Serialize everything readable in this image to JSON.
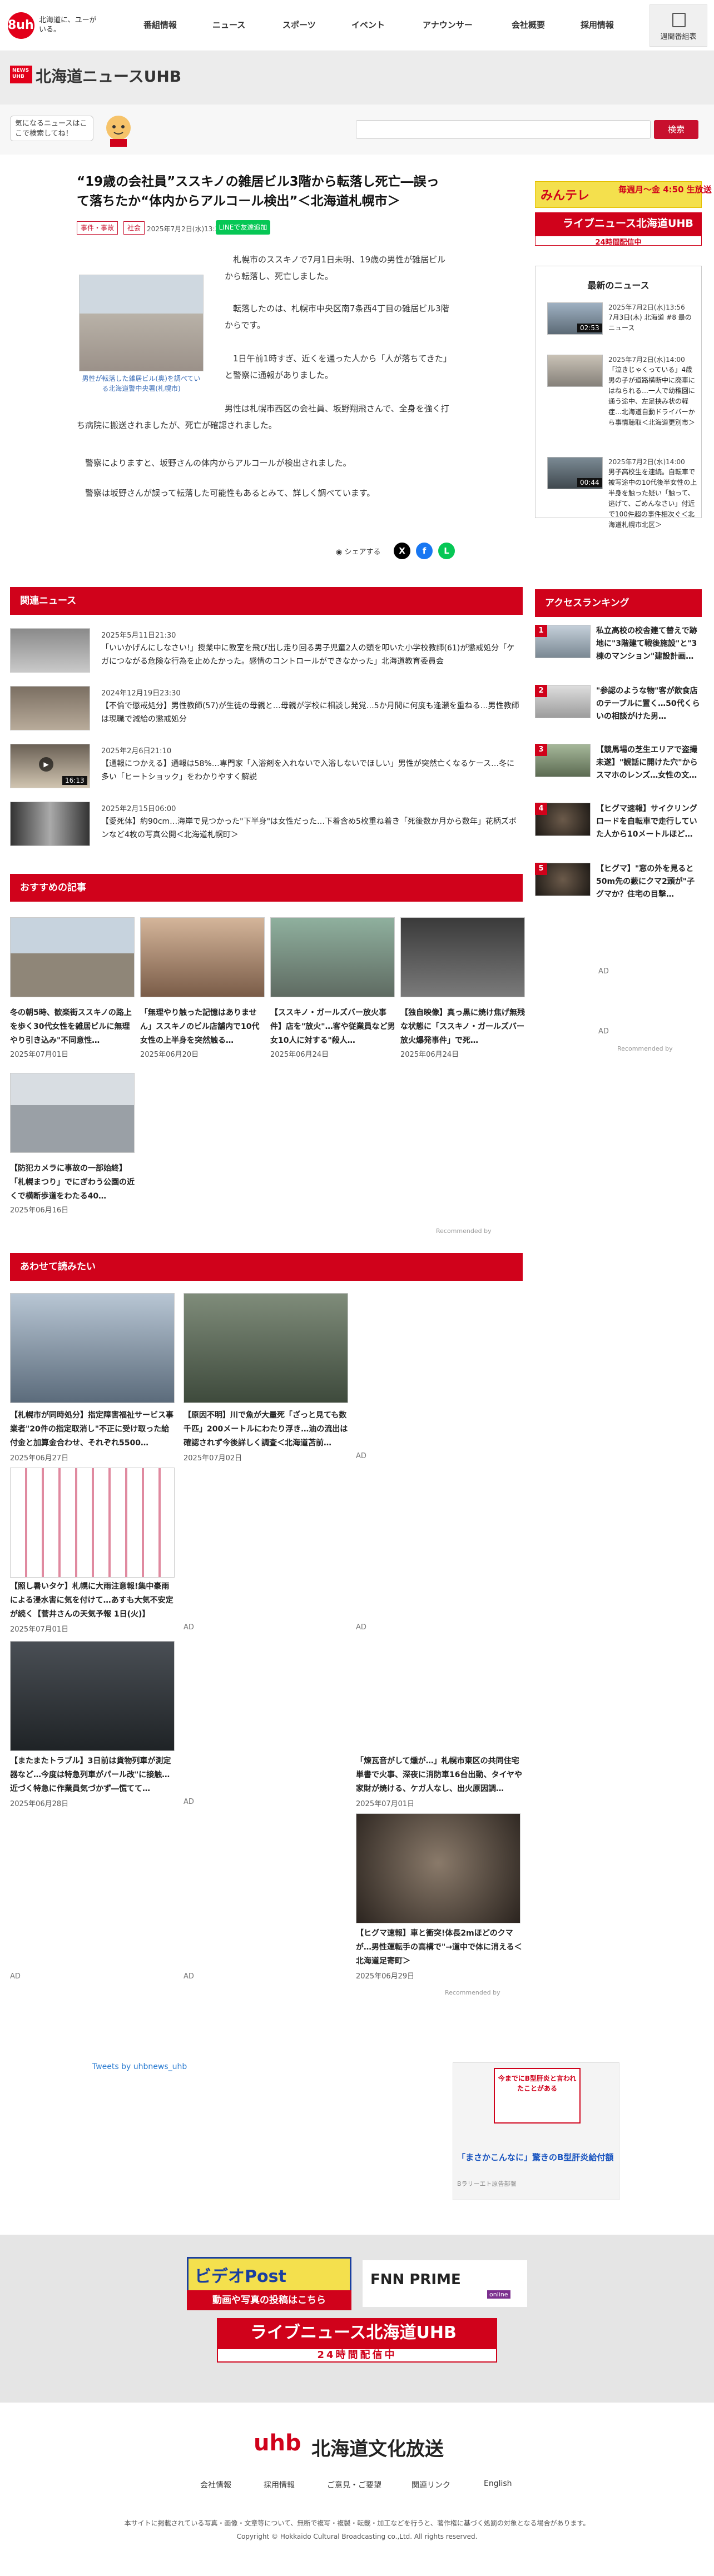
{
  "header": {
    "logo_badge": "8uhb",
    "tagline": "北海道に、ユーがいる。",
    "nav": [
      "番組情報",
      "ニュース",
      "スポーツ",
      "イベント",
      "アナウンサー",
      "会社概要",
      "採用情報"
    ],
    "weekly": "週間番組表"
  },
  "news_header": {
    "logo": "NEWS UHB",
    "title": "北海道ニュースUHB"
  },
  "search": {
    "bubble": "気になるニュースはここで検索してね！",
    "button": "検索",
    "placeholder": ""
  },
  "article": {
    "title": "“19歳の会社員”ススキノの雑居ビル3階から転落し死亡―誤って落ちたか“体内からアルコール検出”＜北海道札幌市＞",
    "tags": [
      "事件・事故",
      "社会"
    ],
    "date": "2025年7月2日(水)13:34",
    "line": "LINEで友達追加",
    "caption": "男性が転落した雑居ビル(奥)を調べている北海道警中央署(札幌市)",
    "paragraphs": [
      "札幌市のススキノで7月1日未明、19歳の男性が雑居ビルから転落し、死亡しました。",
      "転落したのは、札幌市中央区南7条西4丁目の雑居ビル3階からです。",
      "1日午前1時すぎ、近くを通った人から「人が落ちてきた」と警察に通報がありました。",
      "男性は札幌市西区の会社員、坂野翔飛さんで、全身を強く打ち病院に搬送されましたが、死亡が確認されました。",
      "警察によりますと、坂野さんの体内からアルコールが検出されました。",
      "警察は坂野さんが誤って転落した可能性もあるとみて、詳しく調べています。"
    ],
    "share": "シェアする"
  },
  "related": {
    "heading": "関連ニュース",
    "items": [
      {
        "date": "2025年5月11日21:30",
        "title": "「いいかげんにしなさい!」授業中に教室を飛び出し走り回る男子児童2人の頭を叩いた小学校教師(61)が懲戒処分「ケガにつながる危険な行為を止めたかった。感情のコントロールができなかった」北海道教育委員会"
      },
      {
        "date": "2024年12月19日23:30",
        "title": "【不倫で懲戒処分】男性教師(57)が生徒の母親と…母親が学校に相談し発覚…5か月間に何度も逢瀬を重ねる…男性教師は現職で減給の懲戒処分"
      },
      {
        "date": "2025年2月6日21:10",
        "title": "【通報につかえる】通報は58%…専門家「入浴剤を入れないで入浴しないでほしい」男性が突然亡くなるケース…冬に多い「ヒートショック」をわかりやすく解説",
        "duration": "16:13"
      },
      {
        "date": "2025年2月15日06:00",
        "title": "【愛死体】約90cm…海岸で見つかった\"下半身\"は女性だった…下着含め5枚重ね着き「死後数か月から数年」花柄ズボンなど4枚の写真公開＜北海道札幌町＞"
      }
    ]
  },
  "recommended": {
    "heading": "おすすめの記事",
    "items": [
      {
        "title": "冬の朝5時、歓楽街ススキノの路上を歩く30代女性を雑居ビルに無理やり引き込み\"不同意性…",
        "date": "2025年07月01日"
      },
      {
        "title": "「無理やり触った記憶はありません」ススキノのビル店舗内で10代女性の上半身を突然触る…",
        "date": "2025年06月20日"
      },
      {
        "title": "【ススキノ・ガールズバー放火事件】店を\"放火\"…客や従業員など男女10人に対する\"殺人…",
        "date": "2025年06月24日"
      },
      {
        "title": "【独自映像】真っ黒に焼け焦げ無残な状態に「ススキノ・ガールズバー放火爆発事件」で死…",
        "date": "2025年06月24日"
      },
      {
        "title": "【防犯カメラに事故の一部始終】「札幌まつり」でにぎわう公園の近くで横断歩道をわたる40…",
        "date": "2025年06月16日"
      }
    ],
    "powered": "Recommended by"
  },
  "also_read": {
    "heading": "あわせて読みたい",
    "items": [
      {
        "title": "【札幌市が同時処分】指定障害福祉サービス事業者\"20件の指定取消し\"不正に受け取った給付金と加算金合わせ、それぞれ5500…",
        "date": "2025年06月27日"
      },
      {
        "title": "【原因不明】川で魚が大量死「ざっと見ても数千匹」200メートルにわたり浮き…油の流出は確認されず今後詳しく調査＜北海道苫前…",
        "date": "2025年07月02日"
      },
      {
        "title": "【照し暑いタケ】札幌に大雨注意報!集中豪雨による浸水害に気を付けて…あすも大気不安定が続く【菅井さんの天気予報 1日(火)】",
        "date": "2025年07月01日"
      },
      {
        "title": "【またまたトラブル】3日前は貨物列車が測定器など…今度は特急列車がパール改\"に接触…近づく特急に作業員気づかず―慌てて…",
        "date": "2025年06月28日"
      },
      {
        "title": "「煉瓦音がして燻が…」札幌市東区の共同住宅単書で火事、深夜に消防車16台出動、タイヤや家財が焼ける、ケガ人なし、出火原因調…",
        "date": "2025年07月01日"
      },
      {
        "title": "【ヒグマ速報】車と衝突!体長2mほどのクマが…男性運転手の高構で\"→道中で体に消える＜北海道足寄町＞",
        "date": "2025年06月29日"
      }
    ],
    "ad": "AD",
    "powered": "Recommended by"
  },
  "sidebar": {
    "mita_logo": "みんテレ",
    "mita_time": "毎週月〜金 4:50 生放送",
    "live_banner": "ライブニュース北海道UHB",
    "live_sub": "24時間配信中",
    "latest_heading": "最新のニュース",
    "latest": [
      {
        "date": "2025年7月2日(水)13:56",
        "title": "7月3日(木) 北海道 #8 最のニュース",
        "duration": "02:53"
      },
      {
        "date": "2025年7月2日(水)14:00",
        "title": "「泣きじゃくっている」4歳男の子が道路横断中に廃車にはねられる…一人で幼稚園に通う途中、左足挟み状の軽症…北海道自動ドライバーから事情聴取＜北海道更別市＞"
      },
      {
        "date": "2025年7月2日(水)14:00",
        "title": "男子高校生を連続。自転車で被写途中の10代後半女性の上半身を触った疑い「触って、逃げて、ごめんなさい」付近で100件超の事件相次ぐ＜北海道札幌市北区＞",
        "duration": "00:44"
      }
    ],
    "rank_heading": "アクセスランキング",
    "ranking": [
      {
        "n": "1",
        "title": "私立高校の校舎建て替えで跡地に\"3階建て戦後施設\"と\"3棟のマンション\"建設計画…"
      },
      {
        "n": "2",
        "title": "\"参認のような物\"客が飲食店のテーブルに置く…50代くらいの相談がけた男…"
      },
      {
        "n": "3",
        "title": "【競馬場の芝生エリアで盗撮未遂】\"観話に開けた穴\"からスマホのレンズ…女性の文…"
      },
      {
        "n": "4",
        "title": "【ヒグマ速報】サイクリングロードを自転車で走行していた人から10メートルほど…"
      },
      {
        "n": "5",
        "title": "【ヒグマ】\"窓の外を見ると50m先の藪にクマ2頭が\"子グマか？住宅の目撃…"
      }
    ],
    "ad": "AD",
    "powered": "Recommended by"
  },
  "footer": {
    "twitter": "Tweets by uhbnews_uhb",
    "ad_top": "今までにB型肝炎と言われたことがある",
    "ad_title": "「まさかこんなに」驚きのB型肝炎給付額",
    "ad_sub": "Bラリーエト原告部署",
    "videopost": "ビデオPost",
    "videopost_sub": "動画や写真の投稿はこちら",
    "fnn": "FNN PRIME",
    "fnn_sub": "online",
    "live2": "ライブニュース北海道UHB",
    "live2_sub": "24時間配信中",
    "corp_logo": "uhb",
    "corp_name": "北海道文化放送",
    "nav": [
      "会社情報",
      "採用情報",
      "ご意見・ご要望",
      "関連リンク",
      "English"
    ],
    "notice": "本サイトに掲載されている写真・画像・文章等について、無断で複写・複製・転載・加工などを行うと、著作権に基づく処罰の対象となる場合があります。",
    "copyright": "Copyright © Hokkaido Cultural Broadcasting co.,Ltd. All rights reserved."
  },
  "colors": {
    "brand": "#d0021b",
    "line": "#06c755",
    "link": "#2a7bd0"
  }
}
